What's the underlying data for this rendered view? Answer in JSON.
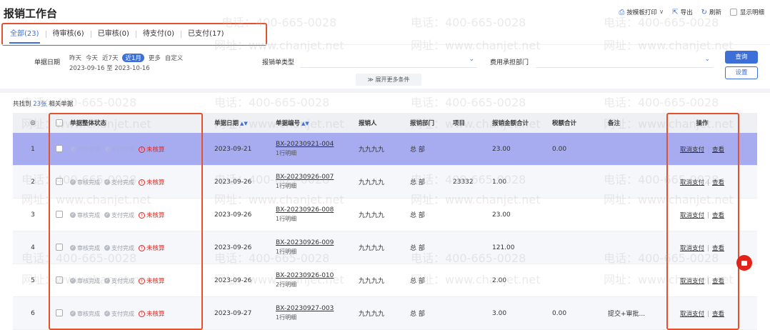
{
  "header": {
    "title": "报销工作台",
    "actions": [
      {
        "icon": "printer-icon",
        "label": "按模板打印",
        "chevron": "∨"
      },
      {
        "icon": "export-icon",
        "label": "导出"
      },
      {
        "icon": "refresh-icon",
        "label": "刷新"
      },
      {
        "icon": "checkbox-icon",
        "label": "显示明细"
      }
    ]
  },
  "tabs": [
    {
      "label": "全部(23)",
      "active": true
    },
    {
      "label": "待审核(6)"
    },
    {
      "label": "已审核(0)"
    },
    {
      "label": "待支付(0)"
    },
    {
      "label": "已支付(17)"
    }
  ],
  "filters": {
    "date_label": "单据日期",
    "date_options": [
      "昨天",
      "今天",
      "近7天",
      "近1月",
      "更多",
      "自定义"
    ],
    "date_selected": "近1月",
    "date_range": "2023-09-16 至 2023-10-16",
    "type_label": "报销单类型",
    "dept_label": "费用承担部门",
    "query_button": "查询",
    "settings_button": "设置",
    "expand_label": "展开更多条件"
  },
  "result": {
    "prefix": "共找到",
    "count": "23张",
    "suffix": "相关单据"
  },
  "table": {
    "headers": {
      "index": "◎",
      "status": "单据整体状态",
      "date": "单据日期",
      "number": "单据编号",
      "person": "报销人",
      "dept": "报销部门",
      "project": "项目",
      "amount": "报销金额合计",
      "tax": "税额合计",
      "remark": "备注",
      "ops": "操作"
    },
    "status_labels": {
      "audit": "审核完成",
      "pay": "支付完成",
      "unsettled": "未核算"
    },
    "rows": [
      {
        "idx": "1",
        "date": "2023-09-21",
        "no": "BX-20230921-004",
        "detail": "1行明细",
        "person": "九九九九",
        "dept": "总 部",
        "project": "",
        "amount": "23.00",
        "tax": "0.00",
        "remark": "",
        "op1": "取消支付",
        "op2": "查看"
      },
      {
        "idx": "2",
        "date": "2023-09-26",
        "no": "BX-20230926-007",
        "detail": "1行明细",
        "person": "九九九九",
        "dept": "总 部",
        "project": "23332",
        "amount": "1.00",
        "tax": "",
        "remark": "",
        "op1": "取消支付",
        "op2": "查看"
      },
      {
        "idx": "3",
        "date": "2023-09-26",
        "no": "BX-20230926-008",
        "detail": "1行明细",
        "person": "九九九九",
        "dept": "总 部",
        "project": "",
        "amount": "23.00",
        "tax": "",
        "remark": "",
        "op1": "取消支付",
        "op2": "查看"
      },
      {
        "idx": "4",
        "date": "2023-09-26",
        "no": "BX-20230926-009",
        "detail": "1行明细",
        "person": "九九九九",
        "dept": "总 部",
        "project": "",
        "amount": "121.00",
        "tax": "",
        "remark": "",
        "op1": "取消支付",
        "op2": "查看"
      },
      {
        "idx": "5",
        "date": "2023-09-26",
        "no": "BX-20230926-010",
        "detail": "2行明细",
        "person": "九九九九",
        "dept": "总 部",
        "project": "",
        "amount": "2.00",
        "tax": "",
        "remark": "",
        "op1": "取消支付",
        "op2": "查看"
      },
      {
        "idx": "6",
        "date": "2023-09-27",
        "no": "BX-20230927-003",
        "detail": "1行明细",
        "person": "九九九九",
        "dept": "总 部",
        "project": "",
        "amount": "3.00",
        "tax": "0.00",
        "remark": "提交+审批...",
        "op1": "取消支付",
        "op2": "查看"
      }
    ]
  },
  "watermarks": {
    "phone": "电话：400-665-0028",
    "site": "网址：www.chanjet.net"
  },
  "colors": {
    "accent": "#3d6fd8",
    "highlight_row": "#a7acf1",
    "annotation": "#e3522f",
    "status_red": "#e2231a"
  }
}
